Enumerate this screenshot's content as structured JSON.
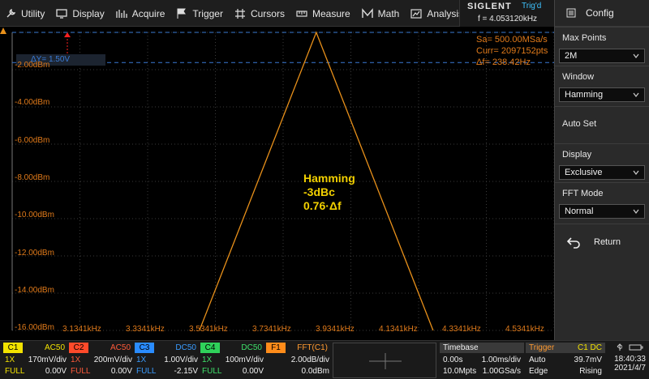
{
  "menu": [
    {
      "label": "Utility",
      "icon": "utility-icon"
    },
    {
      "label": "Display",
      "icon": "display-icon"
    },
    {
      "label": "Acquire",
      "icon": "acquire-icon"
    },
    {
      "label": "Trigger",
      "icon": "trigger-icon"
    },
    {
      "label": "Cursors",
      "icon": "cursors-icon"
    },
    {
      "label": "Measure",
      "icon": "measure-icon"
    },
    {
      "label": "Math",
      "icon": "math-icon"
    },
    {
      "label": "Analysis",
      "icon": "analysis-icon"
    }
  ],
  "brand": {
    "logo": "SIGLENT",
    "trig_status": "Trig'd",
    "frequency": "f = 4.053120kHz"
  },
  "panel": {
    "title": "Config",
    "max_points": {
      "label": "Max Points",
      "value": "2M"
    },
    "window": {
      "label": "Window",
      "value": "Hamming"
    },
    "auto_set": "Auto Set",
    "display": {
      "label": "Display",
      "value": "Exclusive"
    },
    "fft_mode": {
      "label": "FFT Mode",
      "value": "Normal"
    },
    "return": "Return"
  },
  "readout": {
    "sa": "Sa= 500.00MSa/s",
    "curr": "Curr= 2097152pts",
    "df": "Δf= 238.42Hz"
  },
  "cursor": {
    "dy": "ΔY= 1.50V"
  },
  "annotation": {
    "line1": "Hamming",
    "line2": "-3dBc",
    "line3": "0.76·Δf"
  },
  "colors": {
    "trace": "#e8901a",
    "annotation": "#f2d000",
    "cursor": "#3a7bd5",
    "grid": "#3a3a3a"
  },
  "chart_data": {
    "type": "line",
    "y_ticks": [
      "-2.00dBm",
      "-4.00dBm",
      "-6.00dBm",
      "-8.00dBm",
      "-10.00dBm",
      "-12.00dBm",
      "-14.00dBm",
      "-16.00dBm"
    ],
    "x_ticks": [
      "3.1341kHz",
      "3.3341kHz",
      "3.5341kHz",
      "3.7341kHz",
      "3.9341kHz",
      "4.1341kHz",
      "4.3341kHz",
      "4.5341kHz"
    ],
    "xlim": [
      3.1341,
      4.5341
    ],
    "ylim": [
      -16,
      -1.2
    ],
    "series": [
      {
        "x": [
          3.56,
          3.93,
          4.3
        ],
        "y": [
          -16.0,
          -1.2,
          -16.0
        ]
      }
    ],
    "cursors_y": [
      -1.2,
      -2.7
    ]
  },
  "channels": [
    {
      "tag": "C1",
      "coupling": "AC50",
      "probe": "1X",
      "scale": "170mV/div",
      "bw": "FULL",
      "offset": "0.00V",
      "cls": "c1"
    },
    {
      "tag": "C2",
      "coupling": "AC50",
      "probe": "1X",
      "scale": "200mV/div",
      "bw": "FULL",
      "offset": "0.00V",
      "cls": "c2"
    },
    {
      "tag": "C3",
      "coupling": "DC50",
      "probe": "1X",
      "scale": "1.00V/div",
      "bw": "FULL",
      "offset": "-2.15V",
      "cls": "c3"
    },
    {
      "tag": "C4",
      "coupling": "DC50",
      "probe": "1X",
      "scale": "100mV/div",
      "bw": "FULL",
      "offset": "0.00V",
      "cls": "c4"
    },
    {
      "tag": "F1",
      "coupling": "FFT(C1)",
      "probe": "",
      "scale": "2.00dB/div",
      "bw": "",
      "offset": "0.0dBm",
      "cls": "f1"
    }
  ],
  "timebase": {
    "title": "Timebase",
    "delay": "0.00s",
    "scale": "1.00ms/div",
    "points": "10.0Mpts",
    "rate": "1.00GSa/s"
  },
  "trigger": {
    "title": "Trigger",
    "source": "C1 DC",
    "mode": "Auto",
    "level": "39.7mV",
    "type": "Edge",
    "slope": "Rising"
  },
  "system": {
    "time": "18:40:33",
    "date": "2021/4/7"
  }
}
